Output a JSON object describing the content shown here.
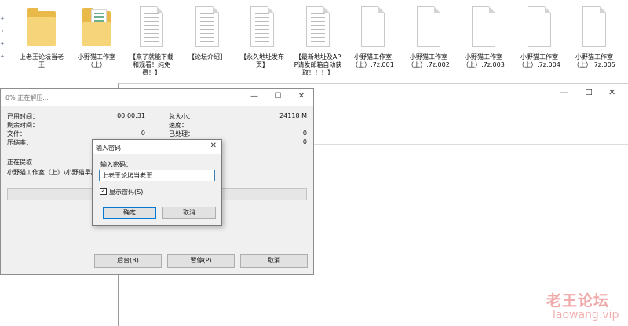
{
  "files": [
    {
      "name": "上老王论坛当老王",
      "icon": "folder-icon"
    },
    {
      "name": "小野猫工作室（上）",
      "icon": "folder-with-document-icon"
    },
    {
      "name": "【来了就能下载和观看！纯免费！】",
      "icon": "text-document-icon"
    },
    {
      "name": "【论坛介绍】",
      "icon": "text-document-icon"
    },
    {
      "name": "【永久地址发布页】",
      "icon": "text-document-icon"
    },
    {
      "name": "【最新地址及APP请发邮箱自动获取！！！】",
      "icon": "text-document-icon"
    },
    {
      "name": "小野猫工作室（上）.7z.001",
      "icon": "blank-file-icon"
    },
    {
      "name": "小野猫工作室（上）.7z.002",
      "icon": "blank-file-icon"
    },
    {
      "name": "小野猫工作室（上）.7z.003",
      "icon": "blank-file-icon"
    },
    {
      "name": "小野猫工作室（上）.7z.004",
      "icon": "blank-file-icon"
    },
    {
      "name": "小野猫工作室（上）.7z.005",
      "icon": "blank-file-icon"
    }
  ],
  "background_window": {
    "minimize": "—",
    "maximize": "☐",
    "close": "✕"
  },
  "progress_dialog": {
    "title": "0% 正在解压...",
    "minimize": "—",
    "maximize": "☐",
    "close": "✕",
    "elapsed_label": "已用时间：",
    "elapsed_value": "00:00:31",
    "remaining_label": "剩余时间：",
    "files_label": "文件：",
    "files_value": "0",
    "ratio_label": "压缩率：",
    "total_size_label": "总大小：",
    "total_size_value": "24118 M",
    "speed_label": "速度：",
    "processed_label": "已处理：",
    "processed_value": "0",
    "packed_value": "0",
    "status_text": "正在提取",
    "current_item": "小野猫工作室（上）\\小野猫早期",
    "progress_percent": 0,
    "progress_color": "#06b025",
    "background_button": "后台(B)",
    "pause_button": "暂停(P)",
    "cancel_button": "取消"
  },
  "password_dialog": {
    "title": "输入密码",
    "close": "✕",
    "prompt": "输入密码：",
    "password_value": "上老王论坛当老王",
    "show_password_label": "显示密码(S)",
    "show_password_checked": true,
    "check_mark": "✓",
    "ok_button": "确定",
    "cancel_button": "取消",
    "focus_color": "#0078d7"
  },
  "watermark": {
    "line1": "老王论坛",
    "line2": "laowang.vip"
  }
}
